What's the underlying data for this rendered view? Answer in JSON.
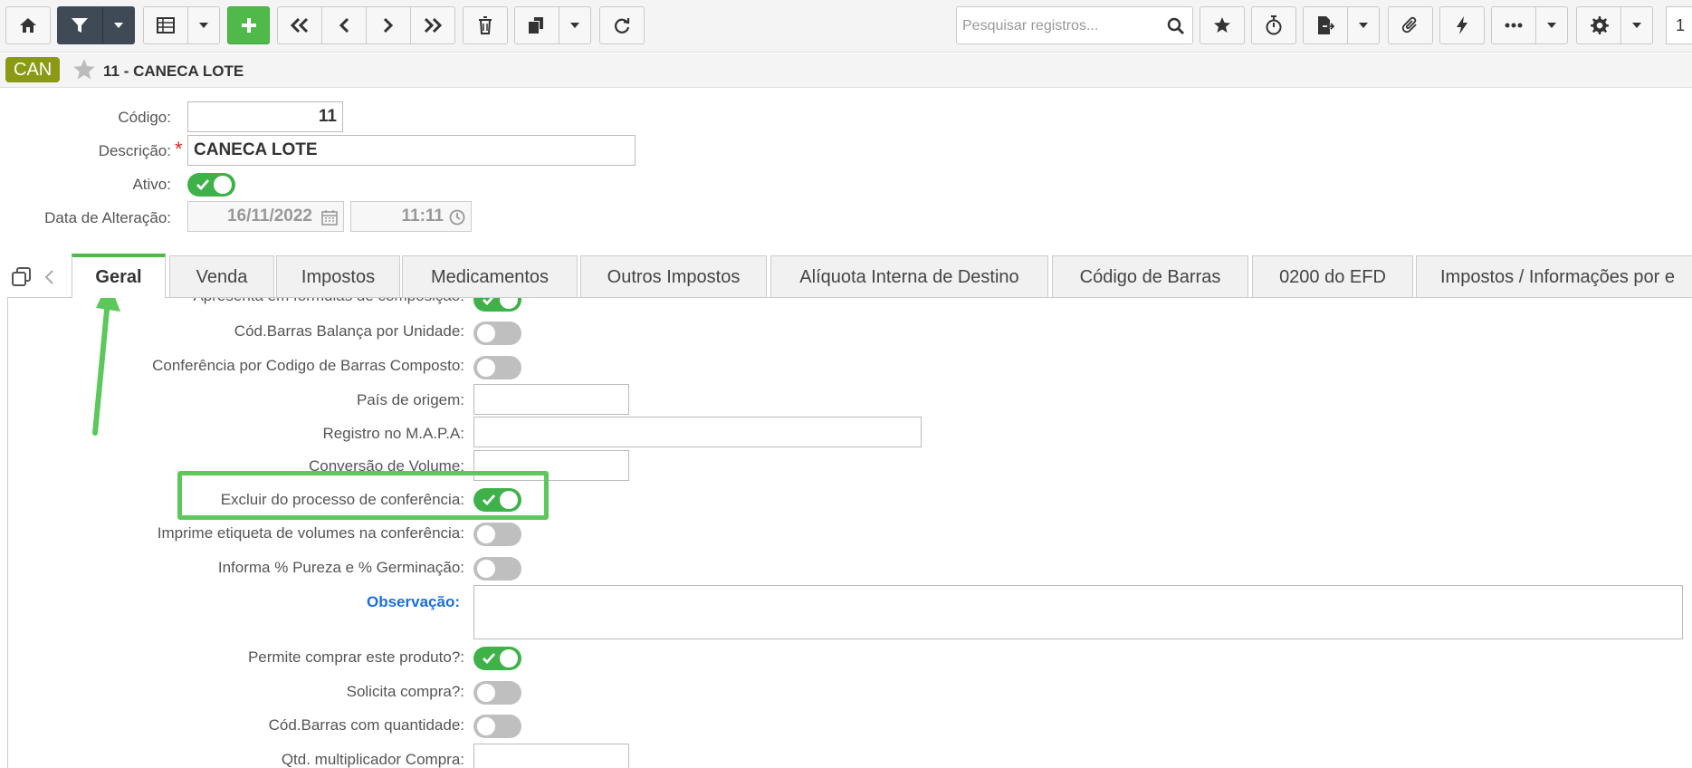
{
  "toolbar": {
    "search_placeholder": "Pesquisar registros...",
    "page_indicator": "1",
    "icons": [
      "home-icon",
      "filter-icon",
      "caret-down-icon",
      "table-icon",
      "caret-down-icon",
      "plus-icon",
      "first-icon",
      "prev-icon",
      "next-icon",
      "last-icon",
      "trash-icon",
      "copy-icon",
      "caret-down-icon",
      "refresh-icon",
      "search-icon",
      "star-icon",
      "stopwatch-icon",
      "export-icon",
      "caret-down-icon",
      "paperclip-icon",
      "bolt-icon",
      "ellipsis-icon",
      "caret-down-icon",
      "gear-icon",
      "caret-down-icon"
    ]
  },
  "header": {
    "badge": "CAN",
    "title": "11 - CANECA LOTE"
  },
  "form": {
    "codigo_label": "Código:",
    "codigo_value": "11",
    "descricao_label": "Descrição:",
    "descricao_required": "*",
    "descricao_value": "CANECA LOTE",
    "ativo_label": "Ativo:",
    "ativo": true,
    "data_alteracao_label": "Data de Alteração:",
    "data_value": "16/11/2022",
    "hora_value": "11:11"
  },
  "tabs": [
    {
      "label": "Geral",
      "active": true
    },
    {
      "label": "Venda"
    },
    {
      "label": "Impostos"
    },
    {
      "label": "Medicamentos"
    },
    {
      "label": "Outros Impostos"
    },
    {
      "label": "Alíquota Interna de Destino"
    },
    {
      "label": "Código de Barras"
    },
    {
      "label": "0200 do EFD"
    },
    {
      "label": "Impostos / Informações por e"
    }
  ],
  "geral": {
    "rows": [
      {
        "label": "Apresenta em fórmulas de composição:",
        "type": "toggle",
        "on": true
      },
      {
        "label": "Cód.Barras Balança por Unidade:",
        "type": "toggle",
        "on": false
      },
      {
        "label": "Conferência por Codigo de Barras Composto:",
        "type": "toggle",
        "on": false
      },
      {
        "label": "País de origem:",
        "type": "input",
        "value": ""
      },
      {
        "label": "Registro no M.A.P.A:",
        "type": "input",
        "value": ""
      },
      {
        "label": "Conversão de Volume:",
        "type": "input",
        "value": ""
      },
      {
        "label": "Excluir do processo de conferência:",
        "type": "toggle",
        "on": true
      },
      {
        "label": "Imprime etiqueta de volumes na conferência:",
        "type": "toggle",
        "on": false
      },
      {
        "label": "Informa % Pureza e % Germinação:",
        "type": "toggle",
        "on": false
      },
      {
        "label": "Observação:",
        "type": "textarea",
        "value": ""
      },
      {
        "label": "Permite comprar este produto?:",
        "type": "toggle",
        "on": true
      },
      {
        "label": "Solicita compra?:",
        "type": "toggle",
        "on": false
      },
      {
        "label": "Cód.Barras com quantidade:",
        "type": "toggle",
        "on": false
      },
      {
        "label": "Qtd. multiplicador Compra:",
        "type": "input",
        "value": ""
      }
    ]
  },
  "colors": {
    "accent_green": "#4fba4a",
    "badge": "#8a9a16",
    "link_blue": "#1a6fe0",
    "dark_btn": "#3f4a56"
  }
}
